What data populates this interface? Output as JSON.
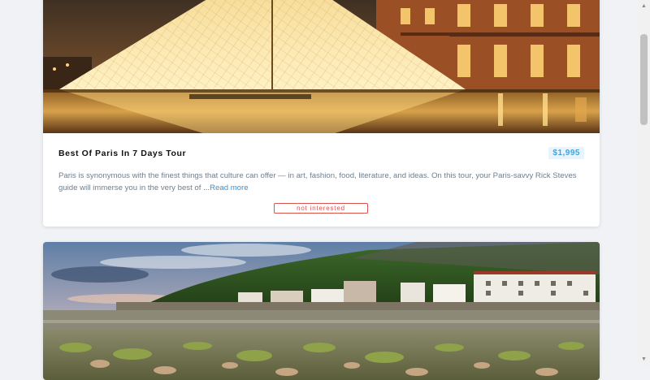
{
  "cards": [
    {
      "image_alt": "Louvre pyramid at night",
      "title": "Best Of Paris In 7 Days Tour",
      "price": "$1,995",
      "description": "Paris is synonymous with the finest things that culture can offer — in art, fashion, food, literature, and ideas. On this tour, your Paris-savvy Rick Steves guide will immerse you in the very best of ...",
      "read_more": "Read more",
      "not_interested": "not interested"
    },
    {
      "image_alt": "Coastal village with green hills"
    }
  ],
  "colors": {
    "price_text": "#3ea4df",
    "price_bg": "#e8f4fd",
    "read_more": "#3a8fd6",
    "not_interested": "#d9534f",
    "background": "#f0f2f5"
  },
  "scrollbar": {
    "up_icon": "arrow-up-icon",
    "down_icon": "arrow-down-icon"
  }
}
